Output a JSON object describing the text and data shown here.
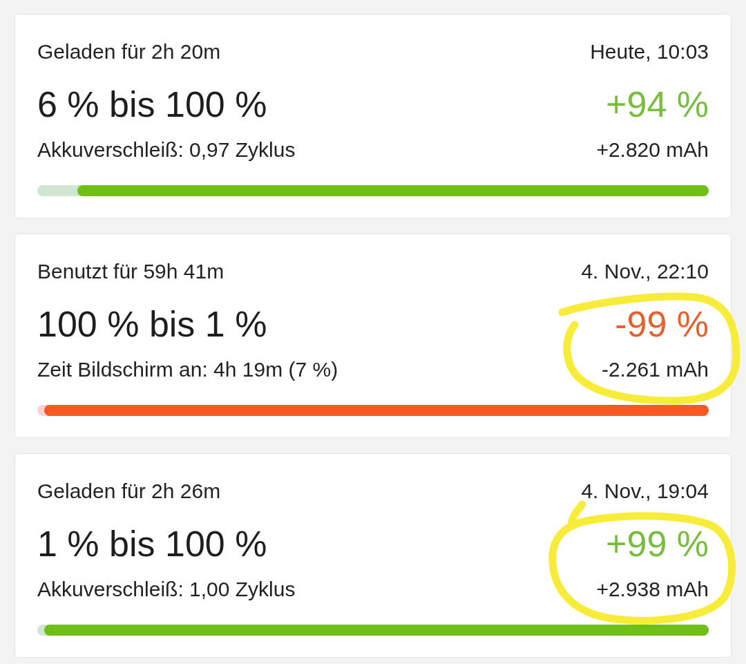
{
  "cards": [
    {
      "kind": "charge",
      "duration": "Geladen für 2h 20m",
      "time": "Heute, 10:03",
      "range": "6 % bis 100 %",
      "change": "+94 %",
      "detail": "Akkuverschleiß: 0,97 Zyklus",
      "capacity": "+2.820 mAh",
      "level": 0.94,
      "circled": false
    },
    {
      "kind": "discharge",
      "duration": "Benutzt für 59h 41m",
      "time": "4. Nov., 22:10",
      "range": "100 % bis 1 %",
      "change": "-99 %",
      "detail": "Zeit Bildschirm an: 4h 19m (7 %)",
      "capacity": "-2.261 mAh",
      "level": 0.99,
      "circled": true
    },
    {
      "kind": "charge",
      "duration": "Geladen für 2h 26m",
      "time": "4. Nov., 19:04",
      "range": "1 % bis 100 %",
      "change": "+99 %",
      "detail": "Akkuverschleiß: 1,00 Zyklus",
      "capacity": "+2.938 mAh",
      "level": 0.99,
      "circled": true
    }
  ]
}
